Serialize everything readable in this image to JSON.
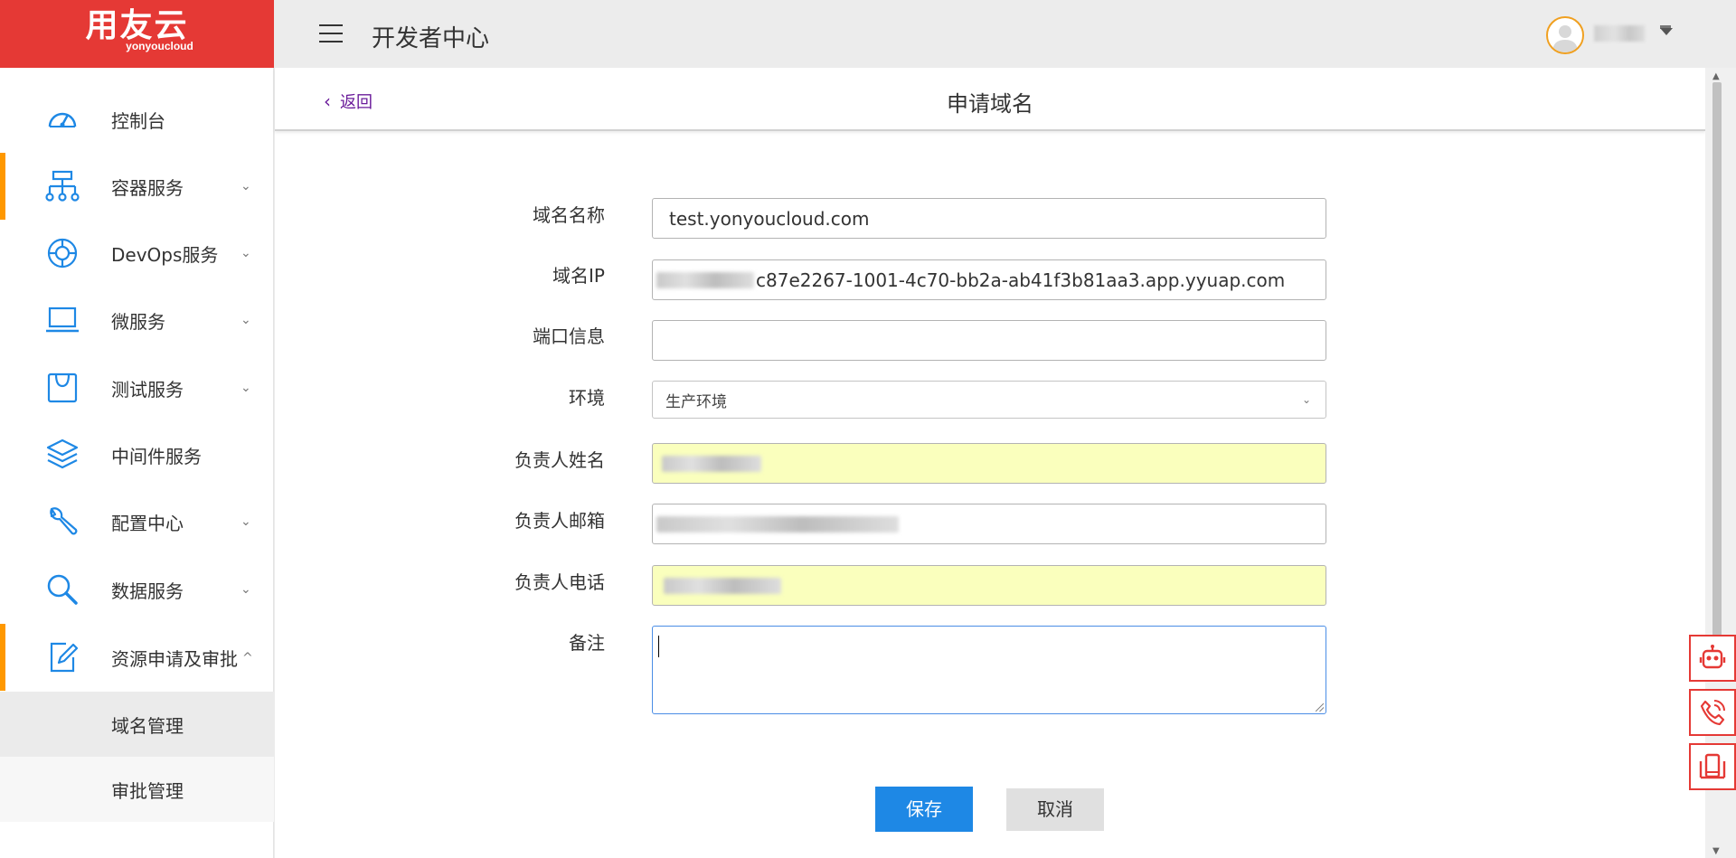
{
  "logo": {
    "main": "用友云",
    "sub": "yonyoucloud"
  },
  "topbar": {
    "title": "开发者中心"
  },
  "sidebar": {
    "items": [
      {
        "label": "控制台",
        "icon": "dashboard-icon"
      },
      {
        "label": "容器服务",
        "icon": "network-tree-icon",
        "has_children": true
      },
      {
        "label": "DevOps服务",
        "icon": "lifebuoy-icon",
        "has_children": true
      },
      {
        "label": "微服务",
        "icon": "laptop-icon",
        "has_children": true
      },
      {
        "label": "测试服务",
        "icon": "shopping-bag-icon",
        "has_children": true
      },
      {
        "label": "中间件服务",
        "icon": "layers-icon"
      },
      {
        "label": "配置中心",
        "icon": "wrench-icon",
        "has_children": true
      },
      {
        "label": "数据服务",
        "icon": "magnifier-icon",
        "has_children": true
      },
      {
        "label": "资源申请及审批",
        "icon": "edit-document-icon",
        "expanded": true
      }
    ],
    "subitems": [
      {
        "label": "域名管理",
        "active": true
      },
      {
        "label": "审批管理",
        "active": false
      }
    ]
  },
  "page": {
    "back": "返回",
    "title": "申请域名"
  },
  "form": {
    "domain_name": {
      "label": "域名名称",
      "value": "test.yonyoucloud.com"
    },
    "domain_ip": {
      "label": "域名IP",
      "value": "c87e2267-1001-4c70-bb2a-ab41f3b81aa3.app.yyuap.com"
    },
    "port": {
      "label": "端口信息",
      "value": ""
    },
    "environment": {
      "label": "环境",
      "value": "生产环境"
    },
    "owner_name": {
      "label": "负责人姓名"
    },
    "owner_email": {
      "label": "负责人邮箱"
    },
    "owner_phone": {
      "label": "负责人电话"
    },
    "remark": {
      "label": "备注",
      "value": ""
    }
  },
  "actions": {
    "save": "保存",
    "cancel": "取消"
  },
  "colors": {
    "brand": "#e53935",
    "primary": "#1e88e5",
    "accent_marker": "#ff9800",
    "icon": "#1e88e5",
    "autofill": "#faffbd"
  }
}
